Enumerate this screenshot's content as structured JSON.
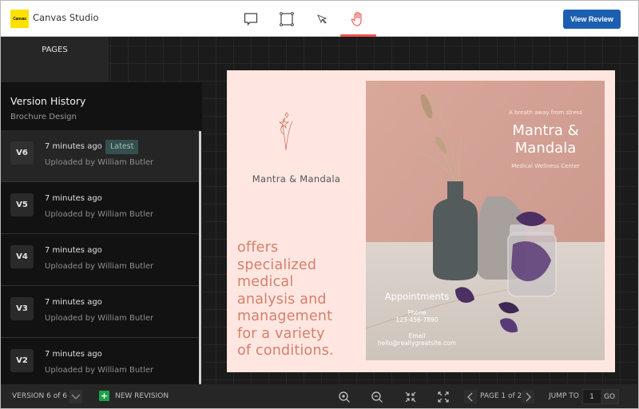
{
  "header": {
    "logo_text": "Canvas",
    "app_title": "Canvas Studio",
    "tools": [
      {
        "name": "comment-tool",
        "icon": "speech-bubble-icon",
        "active": false
      },
      {
        "name": "frame-tool",
        "icon": "frame-select-icon",
        "active": false
      },
      {
        "name": "pointer-tool",
        "icon": "cursor-arrow-icon",
        "active": false
      },
      {
        "name": "hand-tool",
        "icon": "hand-pan-icon",
        "active": true
      }
    ],
    "view_review_label": "View Review",
    "colors": {
      "accent": "#f0554f",
      "primary_button": "#1b5fb0",
      "logo": "#ffe100"
    }
  },
  "sidebar": {
    "pages_tab_label": "PAGES",
    "panel_title": "Version History",
    "panel_subtitle": "Brochure Design",
    "versions": [
      {
        "badge": "V6",
        "time": "7 minutes ago",
        "tag": "Latest",
        "uploaded_by": "Uploaded by William Butler",
        "active": true
      },
      {
        "badge": "V5",
        "time": "7 minutes ago",
        "tag": "",
        "uploaded_by": "Uploaded by William Butler",
        "active": false
      },
      {
        "badge": "V4",
        "time": "7 minutes ago",
        "tag": "",
        "uploaded_by": "Uploaded by William Butler",
        "active": false
      },
      {
        "badge": "V3",
        "time": "7 minutes ago",
        "tag": "",
        "uploaded_by": "Uploaded by William Butler",
        "active": false
      },
      {
        "badge": "V2",
        "time": "7 minutes ago",
        "tag": "",
        "uploaded_by": "Uploaded by William Butler",
        "active": false
      }
    ]
  },
  "brochure": {
    "left_brand": "Mantra & Mandala",
    "blurb_lines": [
      "offers",
      "specialized",
      "medical",
      "analysis and",
      "management",
      "for a variety",
      "of conditions."
    ],
    "photo": {
      "tagline": "A breath away from stress",
      "brand_line1": "Mantra &",
      "brand_line2": "Mandala",
      "subtitle": "Medical Wellness Center",
      "appointments_label": "Appointments",
      "phone_label": "Phone",
      "phone": "123-456-7890",
      "email_label": "Email",
      "email": "hello@reallygreatsite.com"
    },
    "colors": {
      "page_bg": "#ffe6e1",
      "blurb_text": "#d4806a"
    }
  },
  "footer": {
    "version_label": "VERSION 6 of 6",
    "new_revision_label": "NEW REVISION",
    "zoom_in": "zoom-in-icon",
    "zoom_out": "zoom-out-icon",
    "fit": "collapse-icon",
    "fullscreen": "expand-icon",
    "page_label": "PAGE 1 of 2",
    "jump_to_label": "JUMP TO",
    "jump_value": "1",
    "go_label": "GO"
  }
}
